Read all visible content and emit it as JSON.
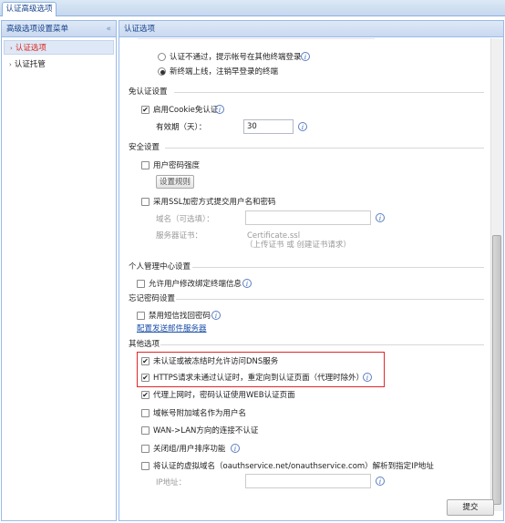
{
  "tabs": {
    "active": "认证高级选项"
  },
  "left_panel": {
    "title": "高级选项设置菜单",
    "collapse_icon": "«",
    "items": [
      {
        "label": "认证选项",
        "selected": true
      },
      {
        "label": "认证托管",
        "selected": false
      }
    ]
  },
  "right_panel": {
    "title": "认证选项",
    "cut_text": "",
    "radio_options": [
      {
        "label": "认证不通过，提示帐号在其他终端登录",
        "checked": false
      },
      {
        "label": "新终端上线，注销早登录的终端",
        "checked": true
      }
    ],
    "cookie_section": {
      "title": "免认证设置",
      "enable_label": "启用Cookie免认证",
      "enable_checked": true,
      "validity_label": "有效期（天）：",
      "validity_value": "30"
    },
    "security_section": {
      "title": "安全设置",
      "password_strength_label": "用户密码强度",
      "password_strength_checked": false,
      "rule_button": "设置规则",
      "ssl_label": "采用SSL加密方式提交用户名和密码",
      "ssl_checked": false,
      "domain_label": "域名（可选填）：",
      "domain_value": "",
      "cert_label": "服务器证书：",
      "cert_file": "Certificate.ssl",
      "cert_upload": "（上传证书 或 创建证书请求）"
    },
    "personal_section": {
      "title": "个人管理中心设置",
      "allow_bind_label": "允许用户修改绑定终端信息",
      "allow_bind_checked": false
    },
    "forgot_section": {
      "title": "忘记密码设置",
      "sms_label": "禁用短信找回密码",
      "sms_checked": false,
      "mail_link": "配置发送邮件服务器"
    },
    "other_section": {
      "title": "其他选项",
      "options": [
        {
          "label": "未认证或被冻结时允许访问DNS服务",
          "checked": true,
          "info": false
        },
        {
          "label": "HTTPS请求未通过认证时，重定向到认证页面（代理时除外）",
          "checked": true,
          "info": true
        },
        {
          "label": "代理上网时，密码认证使用WEB认证页面",
          "checked": true,
          "info": false
        },
        {
          "label": "域帐号附加域名作为用户名",
          "checked": false,
          "info": false
        },
        {
          "label": "WAN->LAN方向的连接不认证",
          "checked": false,
          "info": false
        },
        {
          "label": "关闭组/用户排序功能",
          "checked": false,
          "info": true
        },
        {
          "label": "将认证的虚拟域名（oauthservice.net/onauthservice.com）解析到指定IP地址",
          "checked": false,
          "info": false
        }
      ],
      "ip_label": "IP地址：",
      "ip_value": ""
    },
    "submit_label": "提交"
  }
}
